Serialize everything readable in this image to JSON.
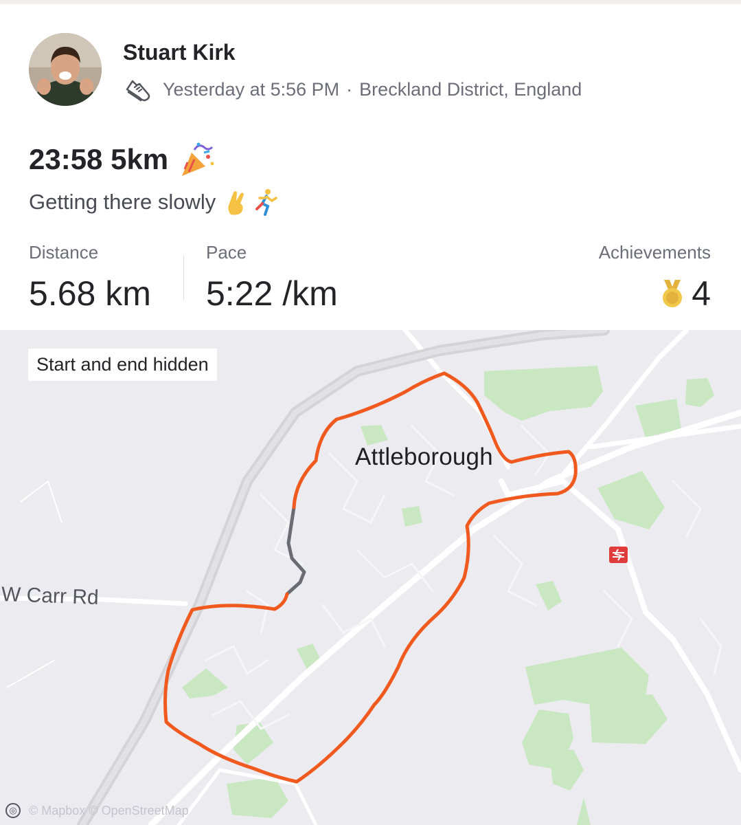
{
  "athlete": {
    "name": "Stuart Kirk",
    "timestamp": "Yesterday at 5:56 PM",
    "separator": "·",
    "location": "Breckland District, England"
  },
  "activity": {
    "title": "23:58 5km",
    "title_emoji": "party-popper",
    "description": "Getting there slowly",
    "description_emojis": [
      "crossed-fingers",
      "runner"
    ]
  },
  "stats": {
    "distance": {
      "label": "Distance",
      "value": "5.68 km"
    },
    "pace": {
      "label": "Pace",
      "value": "5:22 /km"
    },
    "achievements": {
      "label": "Achievements",
      "value": "4",
      "icon": "medal-icon"
    }
  },
  "map": {
    "privacy_label": "Start and end hidden",
    "town": "Attleborough",
    "road": "W Carr Rd",
    "attribution": "© Mapbox © OpenStreetMap",
    "route_color": "#f05a1f",
    "hidden_route_color": "#6b6b74",
    "station_icon": "rail-station-icon"
  },
  "colors": {
    "map_background": "#ebebf0",
    "green_area": "#c9e8c1",
    "road": "#ffffff",
    "bypass": "#d4d4d8"
  }
}
